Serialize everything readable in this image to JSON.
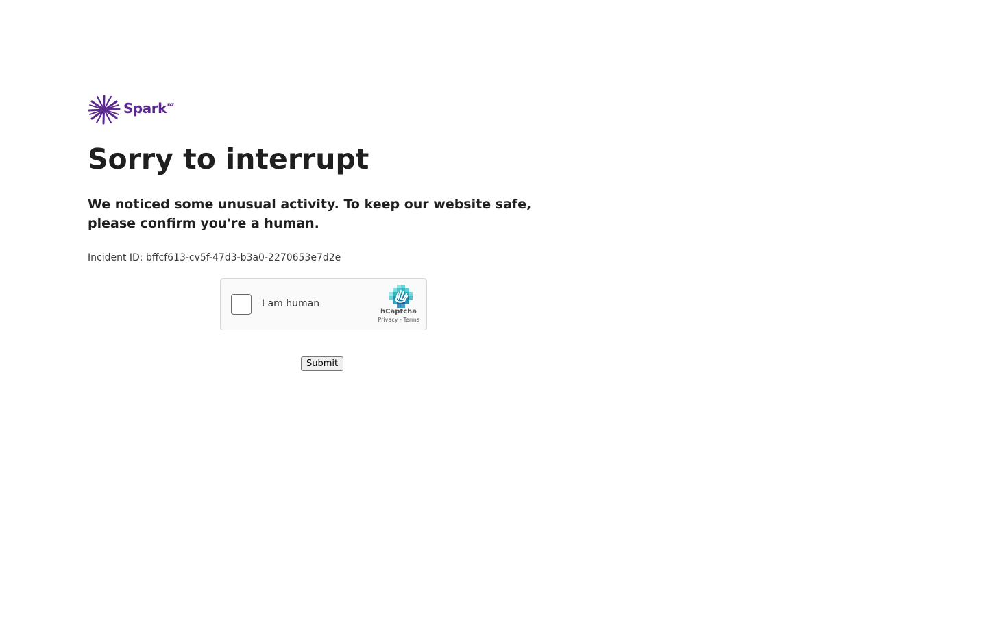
{
  "brand": {
    "name": "Spark",
    "suffix": "nz",
    "color": "#5a2a8c",
    "icon": "spark-star-icon"
  },
  "heading": "Sorry to interrupt",
  "message": "We noticed some unusual activity. To keep our website safe, please confirm you're a human.",
  "incident": {
    "label": "Incident ID:",
    "id": "bffcf613-cv5f-47d3-b3a0-2270653e7d2e"
  },
  "captcha": {
    "label": "I am human",
    "provider": "hCaptcha",
    "privacy": "Privacy",
    "separator": " - ",
    "terms": "Terms",
    "checked": false,
    "icon": "hcaptcha-hand-icon"
  },
  "submit_label": "Submit"
}
